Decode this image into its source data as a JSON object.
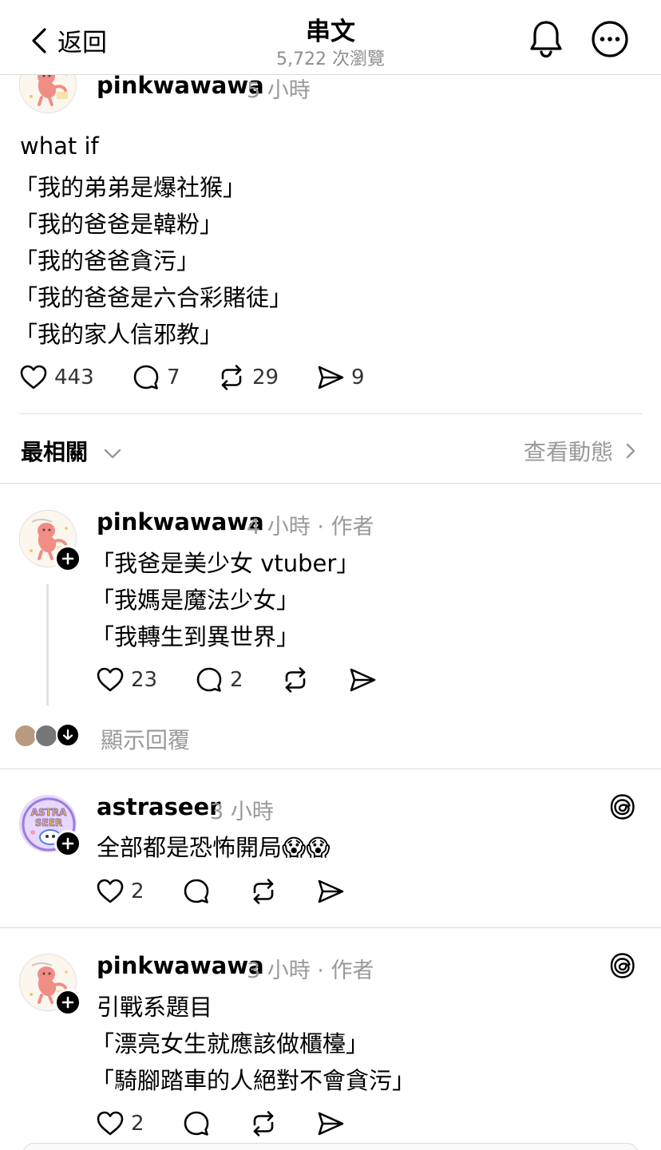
{
  "header": {
    "back_label": "返回",
    "title": "串文",
    "views": "5,722 次瀏覽"
  },
  "main_post": {
    "username": "pinkwawawa",
    "time": "5 小時",
    "lines": [
      "what if",
      "「我的弟弟是爆社猴」",
      "「我的爸爸是韓粉」",
      "「我的爸爸貪污」",
      "「我的爸爸是六合彩賭徒」",
      "「我的家人信邪教」"
    ],
    "likes": "443",
    "comments": "7",
    "reposts": "29",
    "shares": "9"
  },
  "sort": {
    "label": "最相關",
    "activity_label": "查看動態"
  },
  "replies": [
    {
      "username": "pinkwawawa",
      "meta": "4 小時 · 作者",
      "lines": [
        "「我爸是美少女 vtuber」",
        "「我媽是魔法少女」",
        "「我轉生到異世界」"
      ],
      "likes": "23",
      "comments": "2",
      "show_replies": "顯示回覆"
    },
    {
      "username": "astraseer",
      "meta": "3 小時",
      "lines": [
        "全部都是恐怖開局😱😱"
      ],
      "likes": "2"
    },
    {
      "username": "pinkwawawa",
      "meta": "3 小時 · 作者",
      "lines": [
        "引戰系題目",
        "「漂亮女生就應該做櫃檯」",
        "「騎腳踏車的人絕對不會貪污」"
      ],
      "likes": "2"
    }
  ],
  "icons": {
    "back": "chevron-left-icon",
    "bell": "bell-icon",
    "more": "more-icon",
    "like": "heart-icon",
    "comment": "comment-icon",
    "repost": "repost-icon",
    "share": "send-icon",
    "threads": "threads-icon"
  }
}
